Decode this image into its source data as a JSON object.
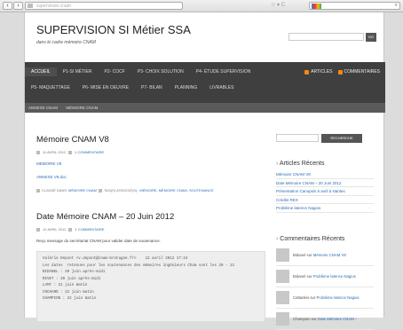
{
  "browser": {
    "back_glyph": "‹",
    "forward_glyph": "›",
    "url_text": "supervision.cnam",
    "url_icons": "☆ ▾ C",
    "search_glyph": "⌕"
  },
  "site": {
    "title": "SUPERVISION SI Métier SSA",
    "description": "dans le cadre mémoire CNAM",
    "search_button": "GO"
  },
  "menu": {
    "row1": [
      "ACCUEIL",
      "P1-SI MÉTIER",
      "P2- COCF",
      "P3- CHOIX SOLUTION",
      "P4- ÉTUDE SUPERVISION"
    ],
    "row2": [
      "P5- MAQUETTAGE",
      "P6- MISE EN OEUVRE",
      "P7- BILAN",
      "PLANNING",
      "LIVRABLES"
    ],
    "feeds": [
      "ARTICLES",
      "COMMENTAIRES"
    ],
    "sub": [
      "ANNEXE CNAM",
      "MÉMOIRE CNAM"
    ]
  },
  "posts": [
    {
      "title": "Mémoire CNAM V8",
      "date": "11 AVRIL 2012",
      "comments": "1 COMMENTAIRE",
      "links": [
        "MEMOIRE V8",
        "ANNEXE V8.doc"
      ],
      "cats_prefix": "CLASSÉ DANS",
      "category": "MÉMOIRE CNAM",
      "tags_prefix": "TAG(S) ASSOCIÉ(S):",
      "tags": "MÉMOIRE, MÉMOIRE CNAM, SOUTENANCE"
    },
    {
      "title": "Date Mémoire CNAM – 20 Juin 2012",
      "date": "12 AVRIL 2012",
      "comments": "1 COMMENTAIRE",
      "excerpt": "Reçu message du secrétariat CNAM pour valider date de soutenance.",
      "pre": "Valérie Depont <v.depont@cnam-bretagne.fr>    12 avril 2012 17:24\nLes dates  retenues pour les soutenances des mémoires ingénieurs Cham sont les 20 - 21\nBIDANEL : 20 juin après-midi\nRIVET : 20 juin après-midi\nLAMY : 21 juin matin\nCOCHARD : 22 juin matin\nCHAMPION : 22 juin matin"
    }
  ],
  "sidebar": {
    "search_button": "RECHERCHE",
    "recent_title": "Articles Récents",
    "recent": [
      "Mémoire CNAM V8",
      "Date Mémoire CNAM – 20 Juin 2012",
      "Présentation Canopsis 5 avril à Nantes",
      "Crédits REX",
      "Problème latence Nagios"
    ],
    "comments_title": "Commentaires Récents",
    "comments": [
      {
        "who": "Bidanel",
        "on": "sur",
        "post": "Mémoire CNAM V8"
      },
      {
        "who": "Bidanel",
        "on": "sur",
        "post": "Problème latence Nagios"
      },
      {
        "who": "Cattadeis",
        "on": "sur",
        "post": "Problème latence Nagios"
      },
      {
        "who": "Champion",
        "on": "sur",
        "post": "Date Mémoire CNAM –"
      }
    ]
  }
}
